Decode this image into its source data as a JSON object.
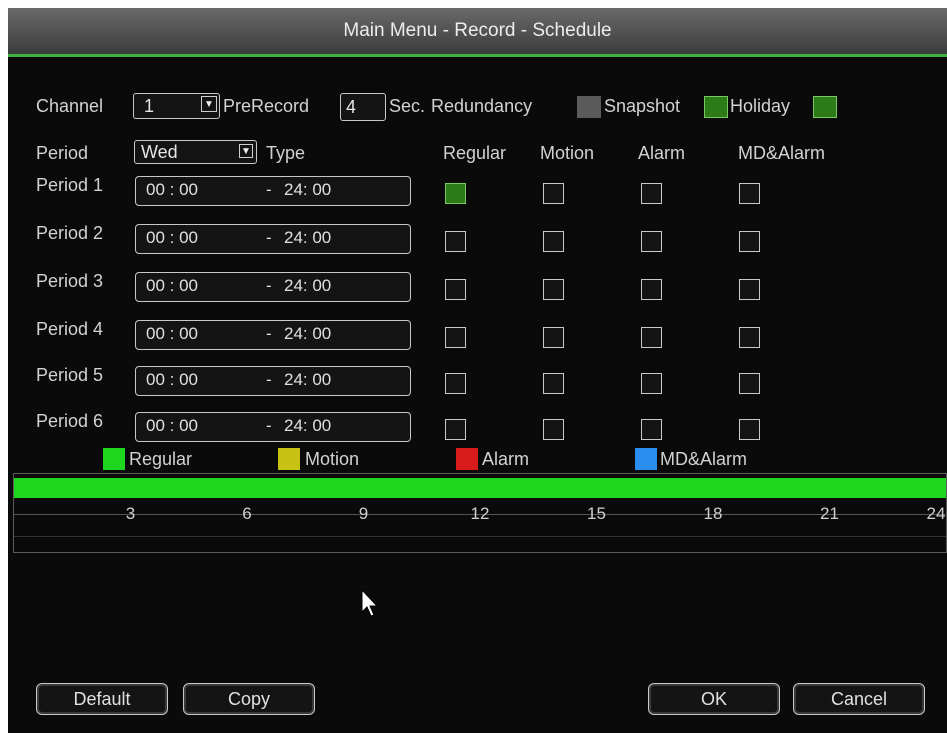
{
  "title": "Main Menu - Record - Schedule",
  "channel": {
    "label": "Channel",
    "value": "1"
  },
  "prerecord": {
    "label": "PreRecord",
    "value": "4",
    "unit": "Sec."
  },
  "redundancy_label": "Redundancy",
  "snapshot_label": "Snapshot",
  "holiday_label": "Holiday",
  "period": {
    "label": "Period",
    "value": "Wed"
  },
  "type_label": "Type",
  "columns": [
    "Regular",
    "Motion",
    "Alarm",
    "MD&Alarm"
  ],
  "periods": [
    {
      "name": "Period 1",
      "start": "00 : 00",
      "end": "24:  00",
      "checks": [
        true,
        false,
        false,
        false
      ]
    },
    {
      "name": "Period 2",
      "start": "00 : 00",
      "end": "24:  00",
      "checks": [
        false,
        false,
        false,
        false
      ]
    },
    {
      "name": "Period 3",
      "start": "00 : 00",
      "end": "24:  00",
      "checks": [
        false,
        false,
        false,
        false
      ]
    },
    {
      "name": "Period 4",
      "start": "00 : 00",
      "end": "24:  00",
      "checks": [
        false,
        false,
        false,
        false
      ]
    },
    {
      "name": "Period 5",
      "start": "00 : 00",
      "end": "24:  00",
      "checks": [
        false,
        false,
        false,
        false
      ]
    },
    {
      "name": "Period 6",
      "start": "00 : 00",
      "end": "24:  00",
      "checks": [
        false,
        false,
        false,
        false
      ]
    }
  ],
  "time_separator": "-",
  "legend": [
    {
      "label": "Regular",
      "color": "#1fd61f"
    },
    {
      "label": "Motion",
      "color": "#c8c214"
    },
    {
      "label": "Alarm",
      "color": "#d81c1c"
    },
    {
      "label": "MD&Alarm",
      "color": "#2a8ef0"
    }
  ],
  "timeline": {
    "ticks": [
      "3",
      "6",
      "9",
      "12",
      "15",
      "18",
      "21",
      "24"
    ],
    "bar_color": "#1fd61f",
    "bar_start_hour": 0,
    "bar_end_hour": 24
  },
  "buttons": {
    "default": "Default",
    "copy": "Copy",
    "ok": "OK",
    "cancel": "Cancel"
  },
  "colors": {
    "accent": "#3fb53f",
    "checked": "#2d7a19",
    "redundancy_box": "#5a5a5a"
  }
}
